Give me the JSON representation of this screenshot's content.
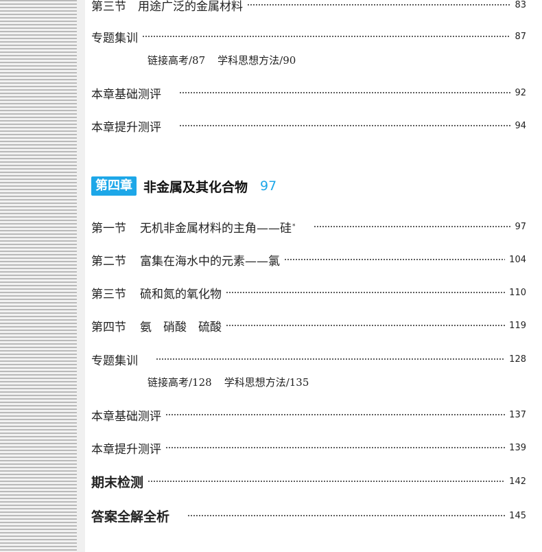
{
  "top_entries": [
    {
      "name": "第三节　用途广泛的金属材料",
      "page": "83"
    },
    {
      "name": "专题集训",
      "page": "87"
    }
  ],
  "top_sub": {
    "a": "链接高考/87",
    "b": "学科思想方法/90"
  },
  "top_tests": [
    {
      "name": "本章基础测评",
      "page": "92"
    },
    {
      "name": "本章提升测评",
      "page": "94"
    }
  ],
  "chapter": {
    "badge": "第四章",
    "title": "非金属及其化合物",
    "page": "97",
    "accent": "#1da7e8"
  },
  "sections": [
    {
      "label": "第一节",
      "name": "无机非金属材料的主角——硅",
      "mark": "*",
      "page": "97"
    },
    {
      "label": "第二节",
      "name": "富集在海水中的元素——氯",
      "mark": "",
      "page": "104"
    },
    {
      "label": "第三节",
      "name": "硫和氮的氧化物",
      "mark": "",
      "page": "110"
    },
    {
      "label": "第四节",
      "name": "氨　硝酸　硫酸",
      "mark": "",
      "page": "119"
    }
  ],
  "special": {
    "name": "专题集训",
    "page": "128"
  },
  "special_sub": {
    "a": "链接高考/128",
    "b": "学科思想方法/135"
  },
  "tests": [
    {
      "name": "本章基础测评",
      "page": "137"
    },
    {
      "name": "本章提升测评",
      "page": "139"
    }
  ],
  "finals": [
    {
      "name": "期末检测",
      "page": "142"
    },
    {
      "name": "答案全解全析",
      "page": "145"
    }
  ]
}
